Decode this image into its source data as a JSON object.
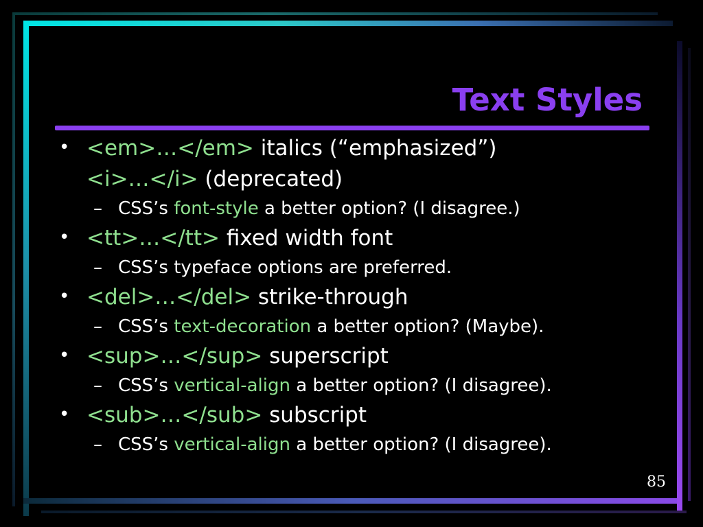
{
  "slide": {
    "title": "Text Styles",
    "page_number": "85",
    "bullet_glyph": "•",
    "dash_glyph": "–",
    "colors": {
      "background": "#000000",
      "title": "#8a3ff0",
      "body_text": "#ffffff",
      "code_text": "#8fe08f"
    },
    "items": [
      {
        "code": "<em>…</em>",
        "text": " italics (“emphasized”)",
        "cont_code": "<i>…</i>",
        "cont_text": " (deprecated)",
        "sub_prefix": "CSS’s ",
        "sub_code": "font-style",
        "sub_suffix": " a better option? (I disagree.)"
      },
      {
        "code": "<tt>…</tt>",
        "text": " fixed width font",
        "sub_text": "CSS’s typeface options are preferred."
      },
      {
        "code": "<del>…</del>",
        "text": " strike-through",
        "sub_prefix": "CSS’s ",
        "sub_code": "text-decoration",
        "sub_suffix": " a better option? (Maybe)."
      },
      {
        "code": "<sup>…</sup>",
        "text": " superscript",
        "sub_prefix": "CSS’s ",
        "sub_code": "vertical-align",
        "sub_suffix": " a better option? (I disagree)."
      },
      {
        "code": "<sub>…</sub>",
        "text": " subscript",
        "sub_prefix": "CSS’s ",
        "sub_code": "vertical-align",
        "sub_suffix": " a better option? (I disagree)."
      }
    ]
  }
}
